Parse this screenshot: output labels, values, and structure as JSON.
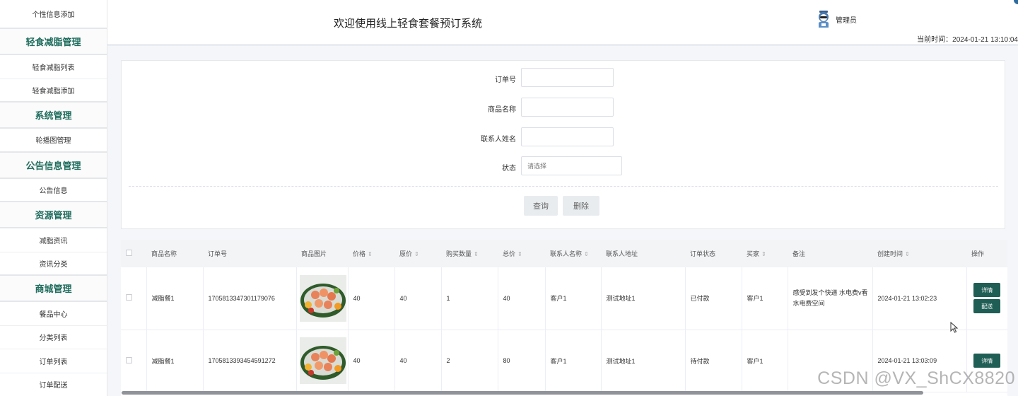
{
  "sidebar": {
    "top_item": "个性信息添加",
    "groups": [
      {
        "title": "轻食减脂管理",
        "items": [
          "轻食减脂列表",
          "轻食减脂添加"
        ]
      },
      {
        "title": "系统管理",
        "items": [
          "轮播图管理"
        ]
      },
      {
        "title": "公告信息管理",
        "items": [
          "公告信息"
        ]
      },
      {
        "title": "资源管理",
        "items": [
          "减脂资讯",
          "资讯分类"
        ]
      },
      {
        "title": "商城管理",
        "items": [
          "餐品中心",
          "分类列表",
          "订单列表",
          "订单配送"
        ]
      }
    ]
  },
  "header": {
    "welcome": "欢迎使用线上轻食套餐预订系统",
    "admin_label": "管理员",
    "time_prefix": "当前时间：",
    "time_value": "2024-01-21 13:10:04"
  },
  "search": {
    "order_no_label": "订单号",
    "product_name_label": "商品名称",
    "contact_name_label": "联系人姓名",
    "status_label": "状态",
    "status_placeholder": "请选择",
    "query_button": "查询",
    "delete_button": "删除"
  },
  "table": {
    "columns": [
      "商品名称",
      "订单号",
      "商品图片",
      "价格",
      "原价",
      "购买数量",
      "总价",
      "联系人名称",
      "联系人地址",
      "订单状态",
      "买家",
      "备注",
      "创建时间",
      "操作"
    ],
    "rows": [
      {
        "product": "减脂餐1",
        "order_no": "1705813347301179076",
        "price": "40",
        "original_price": "40",
        "quantity": "1",
        "total": "40",
        "contact_name": "客户1",
        "contact_address": "测试地址1",
        "status": "已付款",
        "buyer": "客户1",
        "remark": "感受到发个快递 水电费v看 水电费空间",
        "created": "2024-01-21 13:02:23",
        "actions": [
          "详情",
          "配送"
        ]
      },
      {
        "product": "减脂餐1",
        "order_no": "1705813393454591272",
        "price": "40",
        "original_price": "40",
        "quantity": "2",
        "total": "80",
        "contact_name": "客户1",
        "contact_address": "测试地址1",
        "status": "待付款",
        "buyer": "客户1",
        "remark": "",
        "created": "2024-01-21 13:03:09",
        "actions": [
          "详情"
        ]
      }
    ]
  },
  "watermark": "CSDN @VX_ShCX8820",
  "colors": {
    "accent": "#1f5e55",
    "sidebar_group": "#1f6d5e",
    "header_border": "#e9edf2"
  }
}
